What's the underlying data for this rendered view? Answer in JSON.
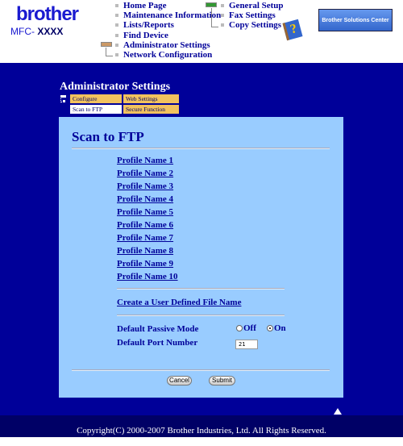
{
  "header": {
    "logo": "brother",
    "model_prefix": "MFC- ",
    "model": "XXXX",
    "solutions_center": "Brother Solutions Center",
    "nav_left": [
      "Home Page",
      "Maintenance Information",
      "Lists/Reports",
      "Find Device",
      "Administrator Settings",
      "Network Configuration"
    ],
    "nav_right": [
      "General Setup",
      "Fax Settings",
      "Copy Settings"
    ]
  },
  "section": {
    "title": "Administrator Settings",
    "tabs": [
      {
        "label": "Configure Password",
        "selected": false
      },
      {
        "label": "Web Settings",
        "selected": false
      },
      {
        "label": "Scan to FTP",
        "selected": true
      },
      {
        "label": "Secure Function Lock",
        "selected": false
      }
    ]
  },
  "panel": {
    "title": "Scan to FTP",
    "profiles": [
      "Profile Name 1",
      "Profile Name 2",
      "Profile Name 3",
      "Profile Name 4",
      "Profile Name 5",
      "Profile Name 6",
      "Profile Name 7",
      "Profile Name 8",
      "Profile Name 9",
      "Profile Name 10"
    ],
    "create_link": "Create a User Defined File Name",
    "passive_label": "Default Passive Mode",
    "passive_off": "Off",
    "passive_on": "On",
    "passive_value": "On",
    "port_label": "Default Port Number",
    "port_value": "21",
    "cancel": "Cancel",
    "submit": "Submit"
  },
  "footer": {
    "copyright": "Copyright(C) 2000-2007 Brother Industries, Ltd. All Rights Reserved."
  }
}
